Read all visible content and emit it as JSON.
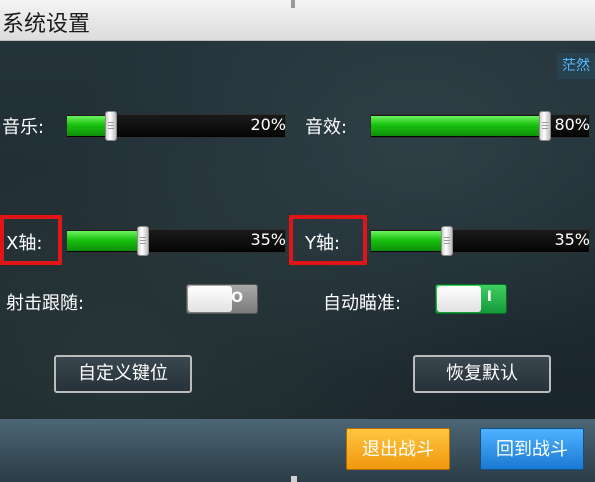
{
  "title": "系统设置",
  "user_badge": "茫然",
  "audio": {
    "music": {
      "label": "音乐:",
      "percent_text": "20%",
      "value_percent": 20
    },
    "sfx": {
      "label": "音效:",
      "percent_text": "80%",
      "value_percent": 80
    }
  },
  "axes": {
    "x": {
      "label": "X轴:",
      "percent_text": "35%",
      "value_percent": 35
    },
    "y": {
      "label": "Y轴:",
      "percent_text": "35%",
      "value_percent": 35
    }
  },
  "toggles": {
    "follow_shoot": {
      "label": "射击跟随:",
      "state": "off",
      "glyph": "O"
    },
    "auto_aim": {
      "label": "自动瞄准:",
      "state": "on",
      "glyph": "I"
    }
  },
  "buttons": {
    "custom_keys": "自定义键位",
    "restore_default": "恢复默认",
    "exit_battle": "退出战斗",
    "return_battle": "回到战斗"
  },
  "colors": {
    "slider_fill": "#19c20f",
    "highlight": "#e11515",
    "toggle_on": "#159a3a",
    "exit_button": "#f0980e",
    "return_button": "#1a79d1"
  }
}
